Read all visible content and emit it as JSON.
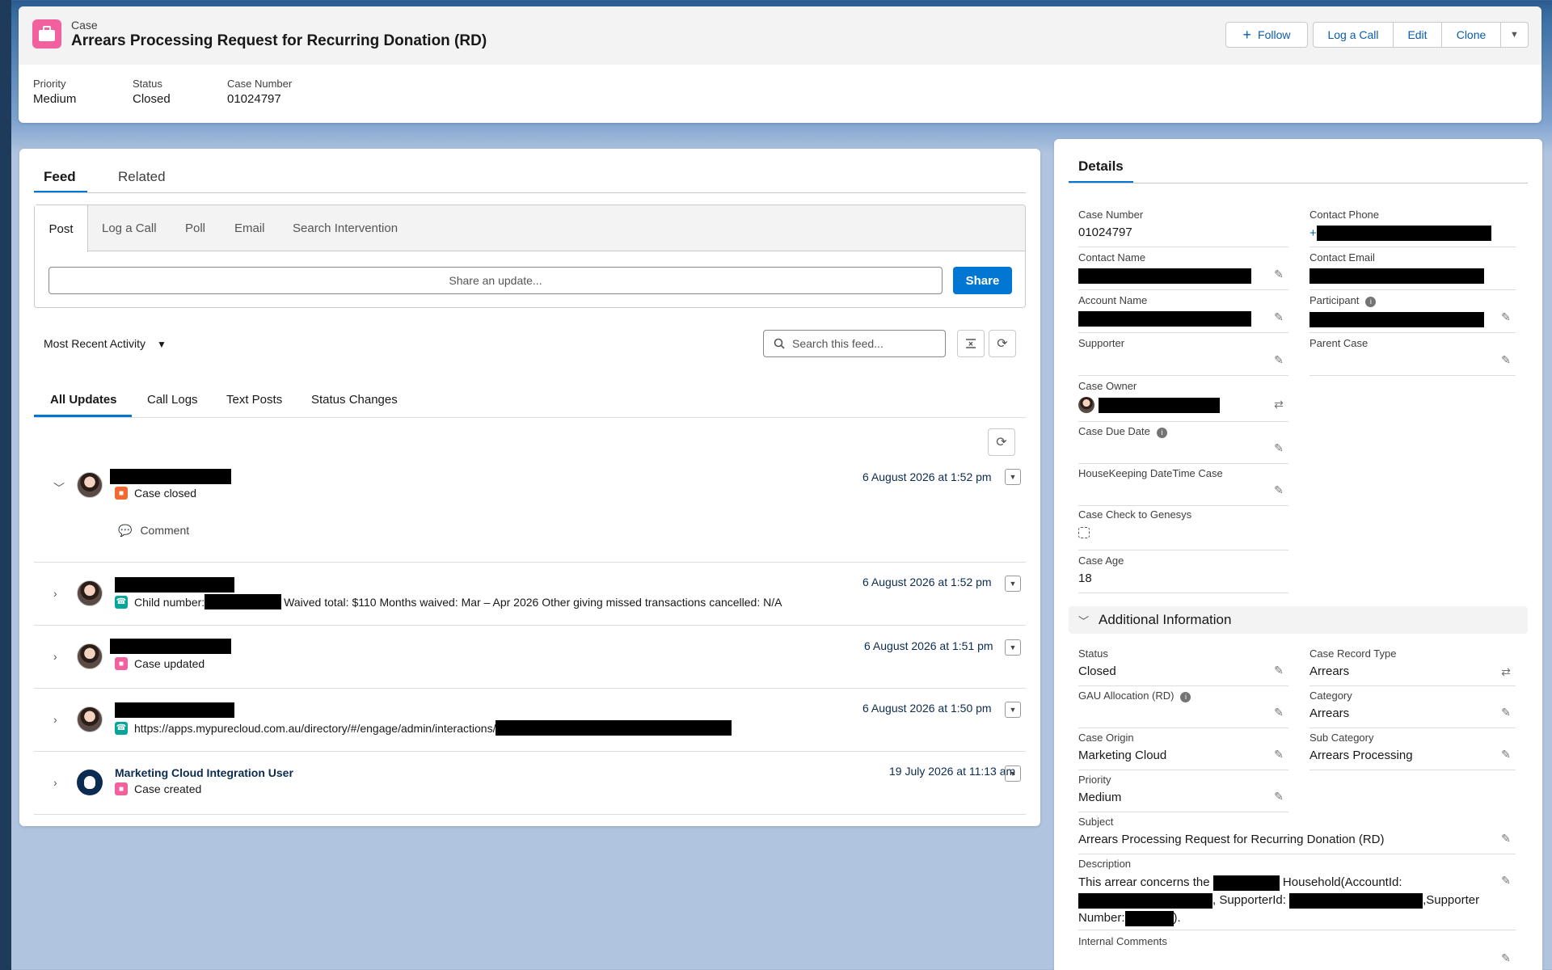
{
  "header": {
    "object_label": "Case",
    "title": "Arrears Processing Request for Recurring Donation (RD)",
    "actions": {
      "follow": "Follow",
      "log_call": "Log a Call",
      "edit": "Edit",
      "clone": "Clone"
    },
    "highlights": [
      {
        "label": "Priority",
        "value": "Medium"
      },
      {
        "label": "Status",
        "value": "Closed"
      },
      {
        "label": "Case Number",
        "value": "01024797"
      }
    ]
  },
  "feed": {
    "tabs": {
      "feed": "Feed",
      "related": "Related"
    },
    "publisher_tabs": {
      "post": "Post",
      "log_call": "Log a Call",
      "poll": "Poll",
      "email": "Email",
      "search": "Search Intervention"
    },
    "share_placeholder": "Share an update...",
    "share_button": "Share",
    "sort_label": "Most Recent Activity",
    "search_placeholder": "Search this feed...",
    "filters": {
      "all": "All Updates",
      "calls": "Call Logs",
      "text": "Text Posts",
      "status": "Status Changes"
    },
    "items": [
      {
        "action": "Case closed",
        "timestamp": "6 August 2026 at 1:52 pm",
        "comment": "Comment",
        "icon": "case-closed-icon",
        "color": "#f06a32"
      },
      {
        "text_before": "Child number:",
        "text_after": "Waived total: $110 Months waived: Mar – Apr 2026 Other giving missed transactions cancelled: N/A",
        "timestamp": "6 August 2026 at 1:52 pm",
        "icon": "call-log-icon",
        "color": "#06a59a"
      },
      {
        "action": "Case updated",
        "timestamp": "6 August 2026 at 1:51 pm",
        "icon": "case-icon",
        "color": "#f2619d"
      },
      {
        "text_before": "https://apps.mypurecloud.com.au/directory/#/engage/admin/interactions/",
        "timestamp": "6 August 2026 at 1:50 pm",
        "icon": "call-log-icon",
        "color": "#06a59a"
      },
      {
        "user": "Marketing Cloud Integration User",
        "action": "Case created",
        "timestamp": "19 July 2026 at 11:13 am",
        "icon": "case-icon",
        "color": "#f2619d"
      }
    ]
  },
  "details": {
    "tab": "Details",
    "case_number": {
      "label": "Case Number",
      "value": "01024797"
    },
    "contact_phone": {
      "label": "Contact Phone",
      "prefix": "+"
    },
    "contact_name": {
      "label": "Contact Name"
    },
    "contact_email": {
      "label": "Contact Email"
    },
    "account_name": {
      "label": "Account Name"
    },
    "participant": {
      "label": "Participant"
    },
    "supporter": {
      "label": "Supporter"
    },
    "parent_case": {
      "label": "Parent Case"
    },
    "case_owner": {
      "label": "Case Owner"
    },
    "case_due_date": {
      "label": "Case Due Date"
    },
    "housekeeping": {
      "label": "HouseKeeping DateTime Case"
    },
    "check_genesys": {
      "label": "Case Check to Genesys"
    },
    "case_age": {
      "label": "Case Age",
      "value": "18"
    },
    "additional_section": "Additional Information",
    "status": {
      "label": "Status",
      "value": "Closed"
    },
    "record_type": {
      "label": "Case Record Type",
      "value": "Arrears"
    },
    "gau": {
      "label": "GAU Allocation (RD)"
    },
    "category": {
      "label": "Category",
      "value": "Arrears"
    },
    "origin": {
      "label": "Case Origin",
      "value": "Marketing Cloud"
    },
    "sub_category": {
      "label": "Sub Category",
      "value": "Arrears Processing"
    },
    "priority": {
      "label": "Priority",
      "value": "Medium"
    },
    "subject": {
      "label": "Subject",
      "value": "Arrears Processing Request for Recurring Donation (RD)"
    },
    "description": {
      "label": "Description",
      "p1": "This arrear concerns the",
      "p2": "Household(AccountId:",
      "p3": ", SupporterId:",
      "p4": ",Supporter",
      "p5": "Number:",
      "p6": ")."
    },
    "internal_comments": {
      "label": "Internal Comments"
    }
  }
}
